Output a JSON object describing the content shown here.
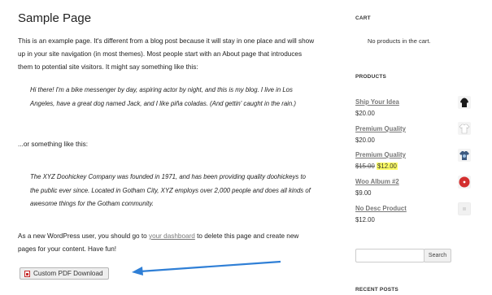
{
  "page": {
    "title": "Sample Page",
    "intro": "This is an example page. It's different from a blog post because it will stay in one place and will show up in your site navigation (in most themes). Most people start with an About page that introduces them to potential site visitors. It might say something like this:",
    "quote1": "Hi there! I'm a bike messenger by day, aspiring actor by night, and this is my blog. I live in Los Angeles, have a great dog named Jack, and I like piña coladas. (And gettin' caught in the rain.)",
    "or_text": "...or something like this:",
    "quote2": "The XYZ Doohickey Company was founded in 1971, and has been providing quality doohickeys to the public ever since. Located in Gotham City, XYZ employs over 2,000 people and does all kinds of awesome things for the Gotham community.",
    "outro_before": "As a new WordPress user, you should go to ",
    "outro_link": "your dashboard",
    "outro_after": " to delete this page and create new pages for your content. Have fun!",
    "pdf_button": "Custom PDF Download"
  },
  "sidebar": {
    "cart_title": "CART",
    "cart_empty": "No products in the cart.",
    "products_title": "PRODUCTS",
    "products": [
      {
        "name": "Ship Your Idea",
        "price": "$20.00",
        "icon": "black-hoodie-thumbnail"
      },
      {
        "name": "Premium Quality",
        "price": "$20.00",
        "icon": "white-tshirt-thumbnail"
      },
      {
        "name": "Premium Quality",
        "old_price": "$15.00",
        "sale_price": "$12.00",
        "icon": "blue-tshirt-thumbnail"
      },
      {
        "name": "Woo Album #2",
        "price": "$9.00",
        "icon": "red-album-thumbnail"
      },
      {
        "name": "No Desc Product",
        "price": "$12.00",
        "icon": "placeholder-thumbnail"
      }
    ],
    "search_button": "Search",
    "recent_posts_title": "RECENT POSTS"
  },
  "colors": {
    "link": "#777777",
    "arrow": "#2f7fd6",
    "sale_highlight": "#ffff66",
    "pdf_icon": "#c62828"
  }
}
